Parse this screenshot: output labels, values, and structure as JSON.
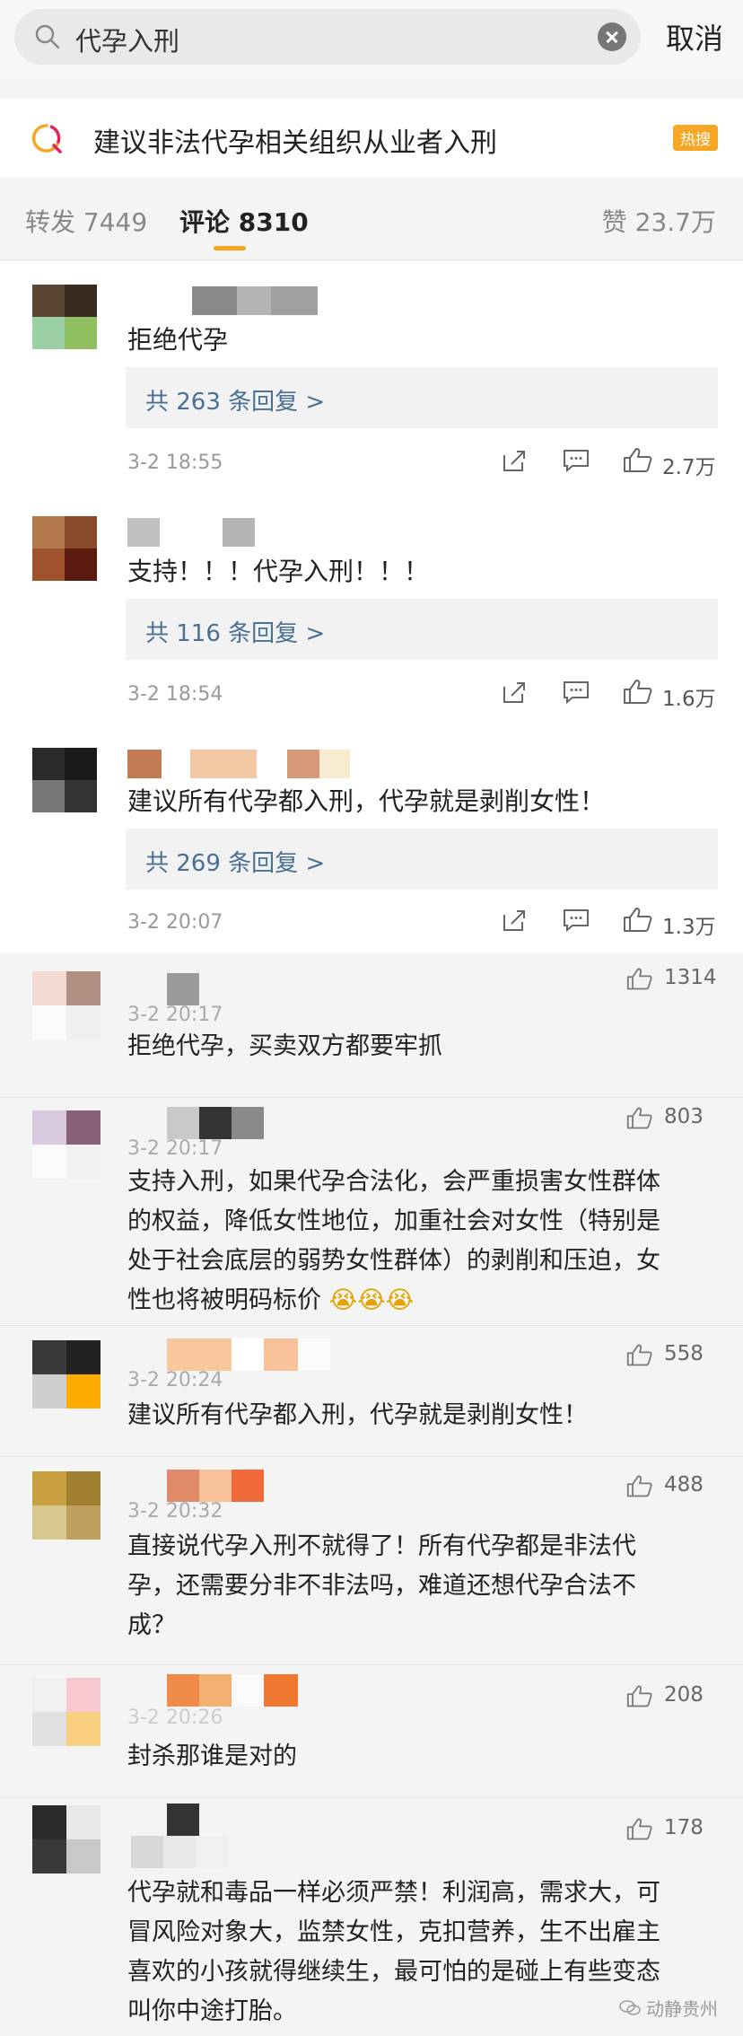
{
  "search": {
    "query": "代孕入刑",
    "cancel_label": "取消"
  },
  "topic": {
    "title": "建议非法代孕相关组织从业者入刑",
    "badge": "热搜"
  },
  "tabs": {
    "repost": "转发 7449",
    "comment": "评论 8310",
    "like": "赞 23.7万"
  },
  "hot_comments": [
    {
      "text": "拒绝代孕",
      "replies": "共 263 条回复 >",
      "time": "3-2 18:55",
      "likes": "2.7万"
    },
    {
      "text": "支持！！！代孕入刑！！！",
      "replies": "共 116 条回复 >",
      "time": "3-2 18:54",
      "likes": "1.6万"
    },
    {
      "text": "建议所有代孕都入刑，代孕就是剥削女性！",
      "replies": "共 269 条回复 >",
      "time": "3-2 20:07",
      "likes": "1.3万"
    }
  ],
  "comments": [
    {
      "time": "3-2 20:17",
      "likes": "1314",
      "lines": [
        "拒绝代孕，买卖双方都要牢抓"
      ]
    },
    {
      "time": "3-2 20:17",
      "likes": "803",
      "lines": [
        "支持入刑，如果代孕合法化，会严重损害女性群体",
        "的权益，降低女性地位，加重社会对女性（特别是",
        "处于社会底层的弱势女性群体）的剥削和压迫，女",
        "性也将被明码标价"
      ]
    },
    {
      "time": "3-2 20:24",
      "likes": "558",
      "lines": [
        "建议所有代孕都入刑，代孕就是剥削女性！"
      ]
    },
    {
      "time": "3-2 20:32",
      "likes": "488",
      "lines": [
        "直接说代孕入刑不就得了！所有代孕都是非法代",
        "孕，还需要分非不非法吗，难道还想代孕合法不",
        "成？"
      ]
    },
    {
      "time": "3-2 20:26",
      "likes": "208",
      "lines": [
        "封杀那谁是对的"
      ]
    },
    {
      "time": "",
      "likes": "178",
      "lines": [
        "代孕就和毒品一样必须严禁！利润高，需求大，可",
        "冒风险对象大，监禁女性，克扣营养，生不出雇主",
        "喜欢的小孩就得继续生，最可怕的是碰上有些变态",
        "叫你中途打胎。"
      ]
    }
  ],
  "watermark": "动静贵州"
}
